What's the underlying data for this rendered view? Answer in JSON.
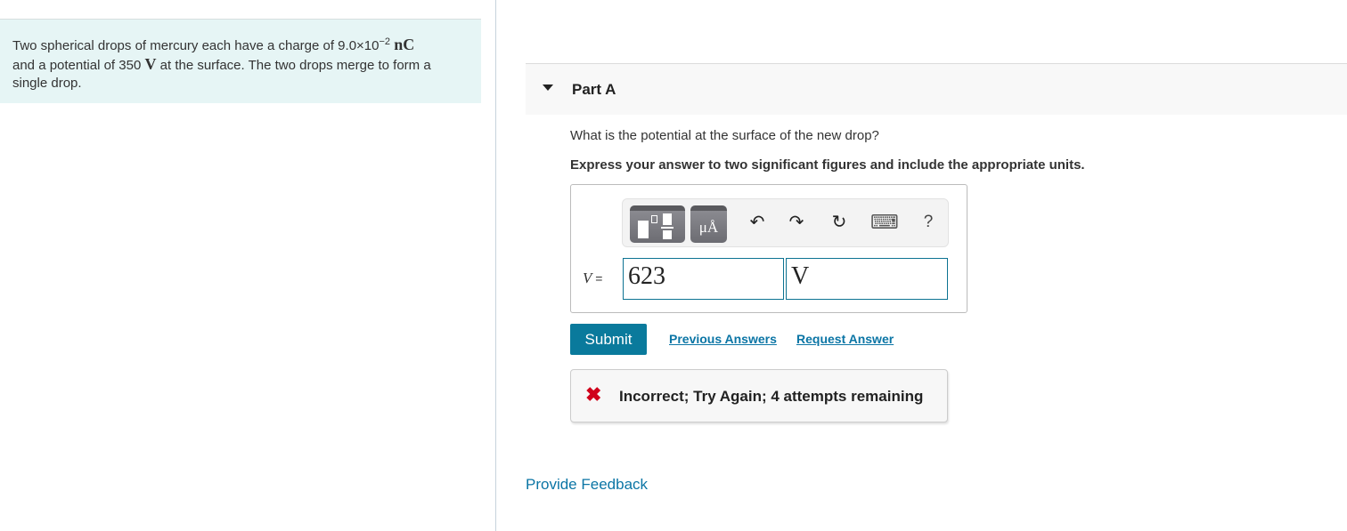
{
  "problem": {
    "text_before_charge": "Two spherical drops of mercury each have a charge of 9.0×10",
    "charge_exponent": "−2",
    "charge_unit": "nC",
    "text_line2_prefix": "and a potential of 350 ",
    "potential_unit": "V",
    "text_after_unit": " at the surface. The two drops merge to form a single drop."
  },
  "part": {
    "title": "Part A",
    "question": "What is the potential at the surface of the new drop?",
    "instruction": "Express your answer to two significant figures and include the appropriate units."
  },
  "toolbar": {
    "units_button_label": "μÅ",
    "undo_icon": "↶",
    "redo_icon": "↷",
    "reset_icon": "↻",
    "keyboard_icon": "⌨",
    "help_icon": "?"
  },
  "answer": {
    "variable": "V",
    "equals": " =",
    "value": "623",
    "unit": "V"
  },
  "actions": {
    "submit_label": "Submit",
    "previous_answers_label": "Previous Answers",
    "request_answer_label": "Request Answer"
  },
  "feedback": {
    "icon": "✖",
    "message": "Incorrect; Try Again; 4 attempts remaining"
  },
  "footer": {
    "provide_feedback_label": "Provide Feedback"
  },
  "colors": {
    "accent": "#0a7a9c",
    "link": "#0b75a5",
    "error": "#d0021b",
    "problem_bg": "#e6f5f5"
  }
}
